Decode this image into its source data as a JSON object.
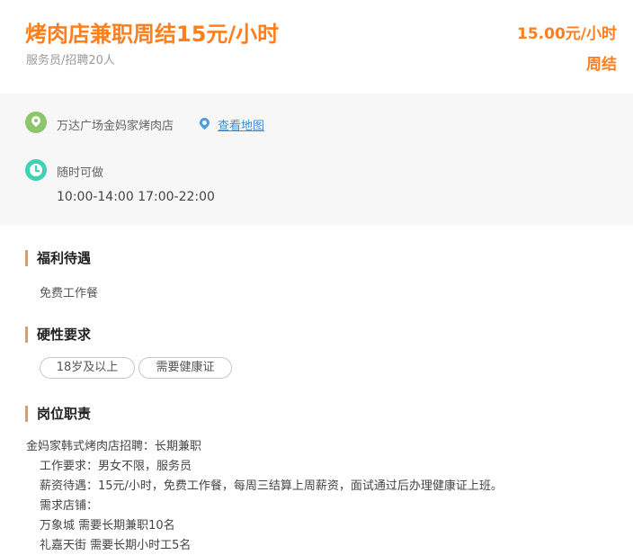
{
  "job": {
    "title": "烤肉店兼职周结15元/小时",
    "subtitle": "服务员/招聘20人",
    "salary": "15.00元/小时",
    "settlement": "周结"
  },
  "location": {
    "address": "万达广场金妈家烤肉店",
    "map_link": "查看地图"
  },
  "schedule": {
    "label": "随时可做",
    "hours": "10:00-14:00 17:00-22:00"
  },
  "benefits": {
    "heading": "福利待遇",
    "text": "免费工作餐"
  },
  "requirements": {
    "heading": "硬性要求",
    "tags": [
      "18岁及以上",
      "需要健康证"
    ]
  },
  "duties": {
    "heading": "岗位职责",
    "lines": [
      "金妈家韩式烤肉店招聘：长期兼职",
      "工作要求：男女不限，服务员",
      "薪资待遇：15元/小时，免费工作餐，每周三结算上周薪资，面试通过后办理健康证上班。",
      "需求店铺：",
      "万象城   需要长期兼职10名",
      "礼嘉天街   需要长期小时工5名"
    ]
  },
  "colors": {
    "accent": "#ff7f1e",
    "section_bar": "#c8a27e",
    "link": "#3a8fd9",
    "location_icon": "#8cc56b",
    "clock_icon": "#3fd2b4"
  },
  "icons": [
    "location-icon",
    "map-pin-icon",
    "clock-icon"
  ]
}
